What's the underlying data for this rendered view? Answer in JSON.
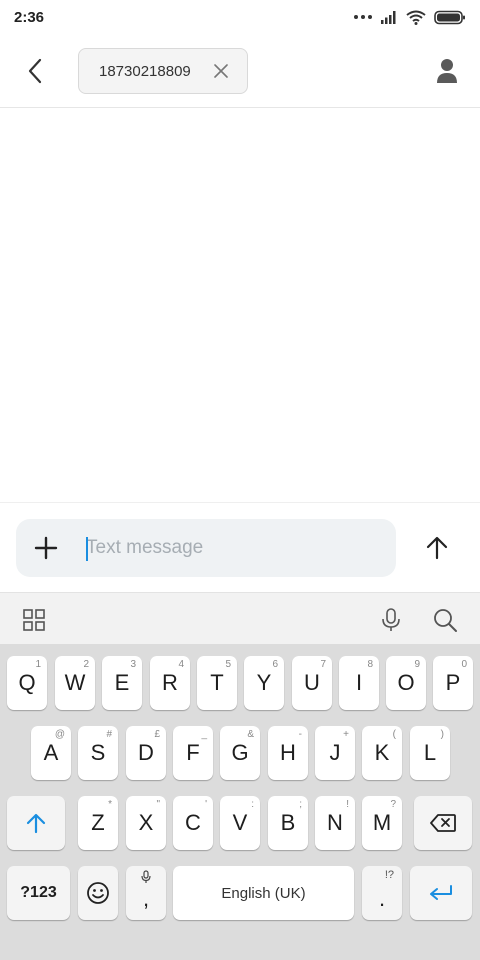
{
  "status_bar": {
    "time": "2:36"
  },
  "recipient": {
    "number": "18730218809"
  },
  "compose": {
    "placeholder": "Text message"
  },
  "keyboard": {
    "row1": [
      {
        "label": "Q",
        "hint": "1"
      },
      {
        "label": "W",
        "hint": "2"
      },
      {
        "label": "E",
        "hint": "3"
      },
      {
        "label": "R",
        "hint": "4"
      },
      {
        "label": "T",
        "hint": "5"
      },
      {
        "label": "Y",
        "hint": "6"
      },
      {
        "label": "U",
        "hint": "7"
      },
      {
        "label": "I",
        "hint": "8"
      },
      {
        "label": "O",
        "hint": "9"
      },
      {
        "label": "P",
        "hint": "0"
      }
    ],
    "row2": [
      {
        "label": "A",
        "hint": "@"
      },
      {
        "label": "S",
        "hint": "#"
      },
      {
        "label": "D",
        "hint": "£"
      },
      {
        "label": "F",
        "hint": "_"
      },
      {
        "label": "G",
        "hint": "&"
      },
      {
        "label": "H",
        "hint": "-"
      },
      {
        "label": "J",
        "hint": "+"
      },
      {
        "label": "K",
        "hint": "("
      },
      {
        "label": "L",
        "hint": ")"
      }
    ],
    "row3": [
      {
        "label": "Z",
        "hint": "*"
      },
      {
        "label": "X",
        "hint": "\""
      },
      {
        "label": "C",
        "hint": "'"
      },
      {
        "label": "V",
        "hint": ":"
      },
      {
        "label": "B",
        "hint": ";"
      },
      {
        "label": "N",
        "hint": "!"
      },
      {
        "label": "M",
        "hint": "?"
      }
    ],
    "symbols_label": "?123",
    "comma_label": ",",
    "space_label": "English (UK)",
    "period_label": ".",
    "period_hint": "!?"
  },
  "colors": {
    "accent": "#1a8ee0",
    "keyboard_bg": "#dcdcdc",
    "compose_bg": "#eff2f4"
  },
  "icons": [
    "back-arrow-icon",
    "close-icon",
    "contact-icon",
    "plus-icon",
    "send-arrow-icon",
    "grid-icon",
    "mic-icon",
    "search-icon",
    "shift-icon",
    "backspace-icon",
    "emoji-icon",
    "enter-icon"
  ]
}
